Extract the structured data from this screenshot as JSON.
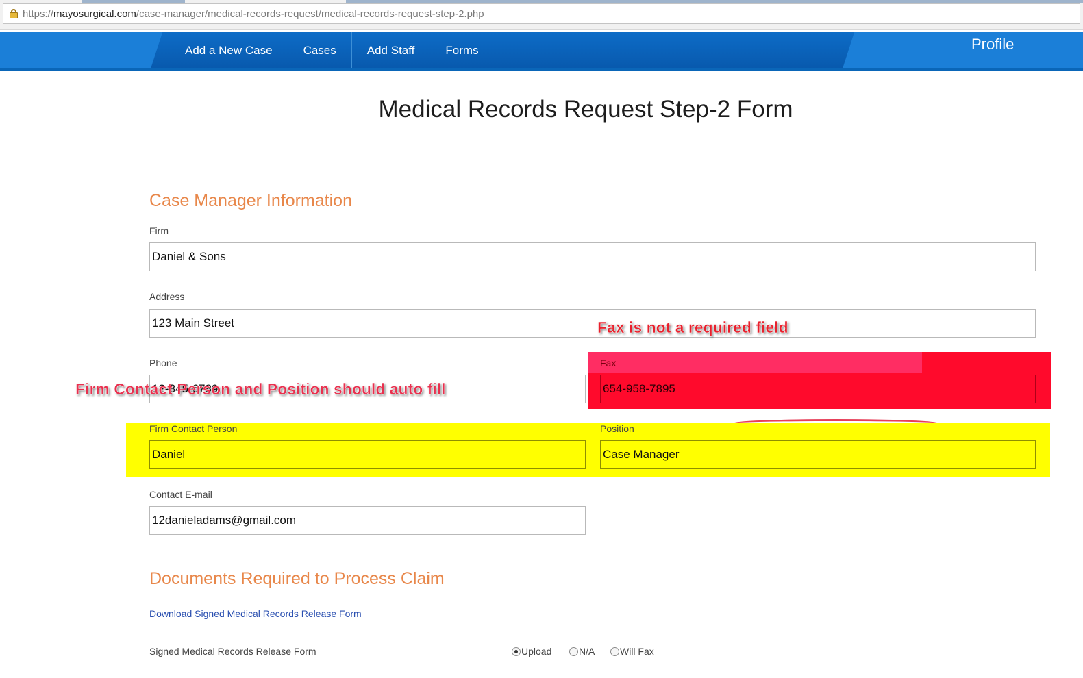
{
  "browser": {
    "url_scheme": "https://",
    "url_domain": "mayosurgical.com",
    "url_path": "/case-manager/medical-records-request/medical-records-request-step-2.php"
  },
  "nav": {
    "items": [
      "Add a New Case",
      "Cases",
      "Add Staff",
      "Forms"
    ],
    "profile": "Profile"
  },
  "page": {
    "title": "Medical Records Request Step-2 Form"
  },
  "case_manager": {
    "heading": "Case Manager Information",
    "firm": {
      "label": "Firm",
      "value": "Daniel & Sons"
    },
    "address": {
      "label": "Address",
      "value": "123 Main Street"
    },
    "phone": {
      "label": "Phone",
      "value": "12-345-6789"
    },
    "fax": {
      "label": "Fax",
      "value": "654-958-7895"
    },
    "contact_person": {
      "label": "Firm Contact Person",
      "value": "Daniel"
    },
    "position": {
      "label": "Position",
      "value": "Case Manager"
    },
    "email": {
      "label": "Contact E-mail",
      "value": "12danieladams@gmail.com"
    }
  },
  "documents": {
    "heading": "Documents Required to Process Claim",
    "download_link": "Download Signed Medical Records Release Form",
    "release_form_label": "Signed Medical Records Release Form",
    "options": [
      "Upload",
      "N/A",
      "Will Fax"
    ],
    "selected": "Upload"
  },
  "annotations": {
    "fax_note": "Fax is not a required field",
    "autofill_note": "Firm Contact Person and Position should auto fill"
  },
  "colors": {
    "nav_blue": "#1b7fd8",
    "heading_orange": "#e8874a",
    "highlight_red": "#ff0a2c",
    "highlight_yellow": "#ffff00"
  }
}
